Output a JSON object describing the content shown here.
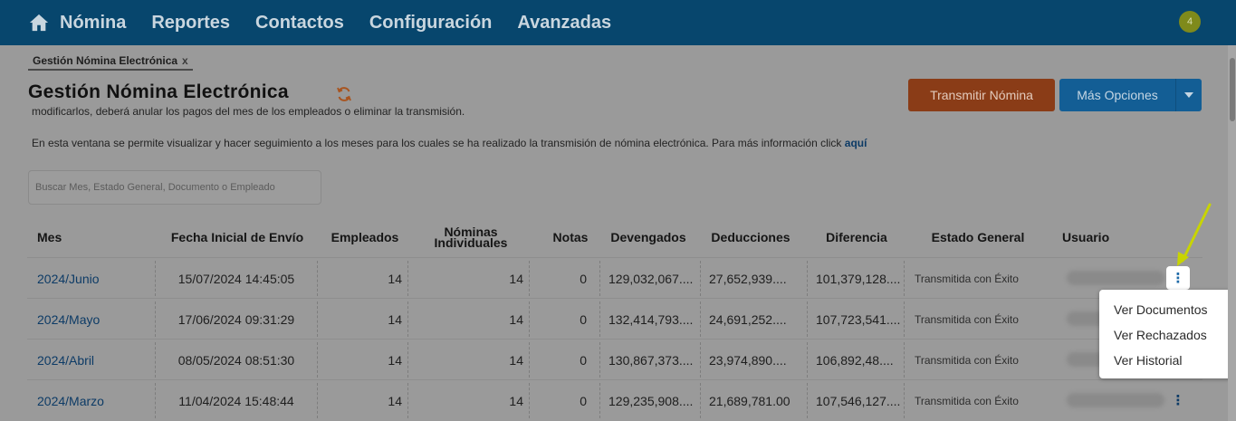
{
  "nav": {
    "items": [
      "Nómina",
      "Reportes",
      "Contactos",
      "Configuración",
      "Avanzadas"
    ],
    "notifications": "4"
  },
  "tab": {
    "label": "Gestión Nómina Electrónica",
    "close": "x"
  },
  "page": {
    "title": "Gestión Nómina Electrónica",
    "desc1": "modificarlos, deberá anular los pagos del mes de los empleados o eliminar la transmisión.",
    "desc2": "En esta ventana se permite visualizar y hacer seguimiento a los meses para los cuales se ha realizado la transmisión de nómina electrónica. Para más información click ",
    "desc2_link": "aquí"
  },
  "buttons": {
    "transmit": "Transmitir Nómina",
    "more": "Más Opciones"
  },
  "search": {
    "placeholder": "Buscar Mes, Estado General, Documento o Empleado"
  },
  "table": {
    "headers": [
      "Mes",
      "Fecha Inicial de Envío",
      "Empleados",
      "Nóminas Individuales",
      "Notas",
      "Devengados",
      "Deducciones",
      "Diferencia",
      "Estado General",
      "Usuario"
    ],
    "rows": [
      [
        "2024/Junio",
        "15/07/2024 14:45:05",
        "14",
        "14",
        "0",
        "129,032,067....",
        "27,652,939....",
        "101,379,128....",
        "Transmitida con Éxito"
      ],
      [
        "2024/Mayo",
        "17/06/2024 09:31:29",
        "14",
        "14",
        "0",
        "132,414,793....",
        "24,691,252....",
        "107,723,541....",
        "Transmitida con Éxito"
      ],
      [
        "2024/Abril",
        "08/05/2024 08:51:30",
        "14",
        "14",
        "0",
        "130,867,373....",
        "23,974,890....",
        "106,892,48....",
        "Transmitida con Éxito"
      ],
      [
        "2024/Marzo",
        "11/04/2024 15:48:44",
        "14",
        "14",
        "0",
        "129,235,908....",
        "21,689,781.00",
        "107,546,127....",
        "Transmitida con Éxito"
      ]
    ]
  },
  "menu": {
    "items": [
      "Ver Documentos",
      "Ver Rechazados",
      "Ver Historial"
    ]
  },
  "colors": {
    "nav_bg": "#07466d",
    "transmit_bg": "#8a3c17",
    "more_bg": "#135e95",
    "link": "#0d3b66",
    "arrow": "#c8d400"
  }
}
